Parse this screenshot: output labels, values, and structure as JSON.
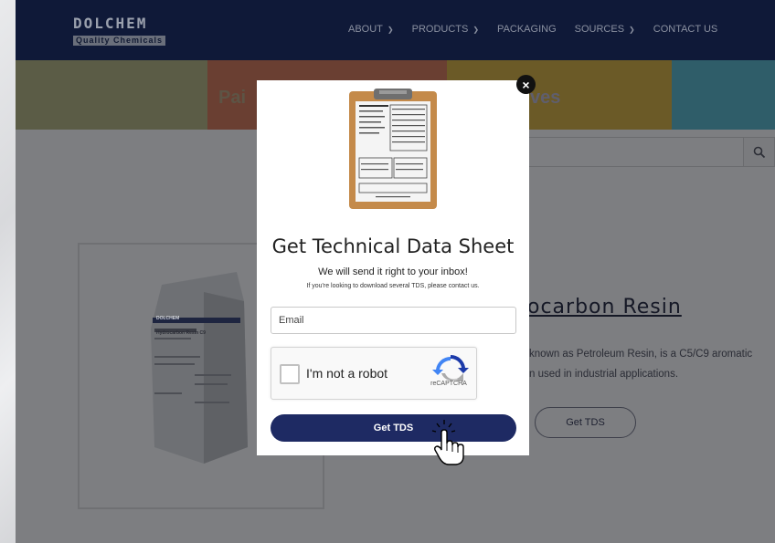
{
  "header": {
    "logo_top": "DOLCHEM",
    "logo_bottom": "Quality Chemicals",
    "nav": [
      {
        "label": "ABOUT",
        "dropdown": true
      },
      {
        "label": "PRODUCTS",
        "dropdown": true
      },
      {
        "label": "PACKAGING",
        "dropdown": false
      },
      {
        "label": "SOURCES",
        "dropdown": true
      },
      {
        "label": "CONTACT US",
        "dropdown": false
      }
    ]
  },
  "banner": {
    "left_text": "Pai",
    "right_text": "ves"
  },
  "search": {
    "placeholder": "",
    "icon": "search-icon"
  },
  "product": {
    "title": "ocarbon Resin",
    "desc_line1": "known as Petroleum Resin, is a C5/C9 aromatic",
    "desc_line2": "n used in industrial applications.",
    "button_label": "Get TDS",
    "bag_brand": "DOLCHEM",
    "bag_label": "Hydrocarbon Resin C9"
  },
  "modal": {
    "title": "Get Technical Data Sheet",
    "subtitle": "We will send it right to your inbox!",
    "small_text": "If you're looking to download several TDS, please contact us.",
    "email_placeholder": "Email",
    "recaptcha_label": "I'm not a robot",
    "recaptcha_brand": "reCAPTCHA",
    "submit_label": "Get TDS",
    "close_symbol": "×"
  },
  "colors": {
    "header_bg": "#0f1938",
    "submit_bg": "#1e2a63",
    "overlay": "#7d7e81"
  }
}
